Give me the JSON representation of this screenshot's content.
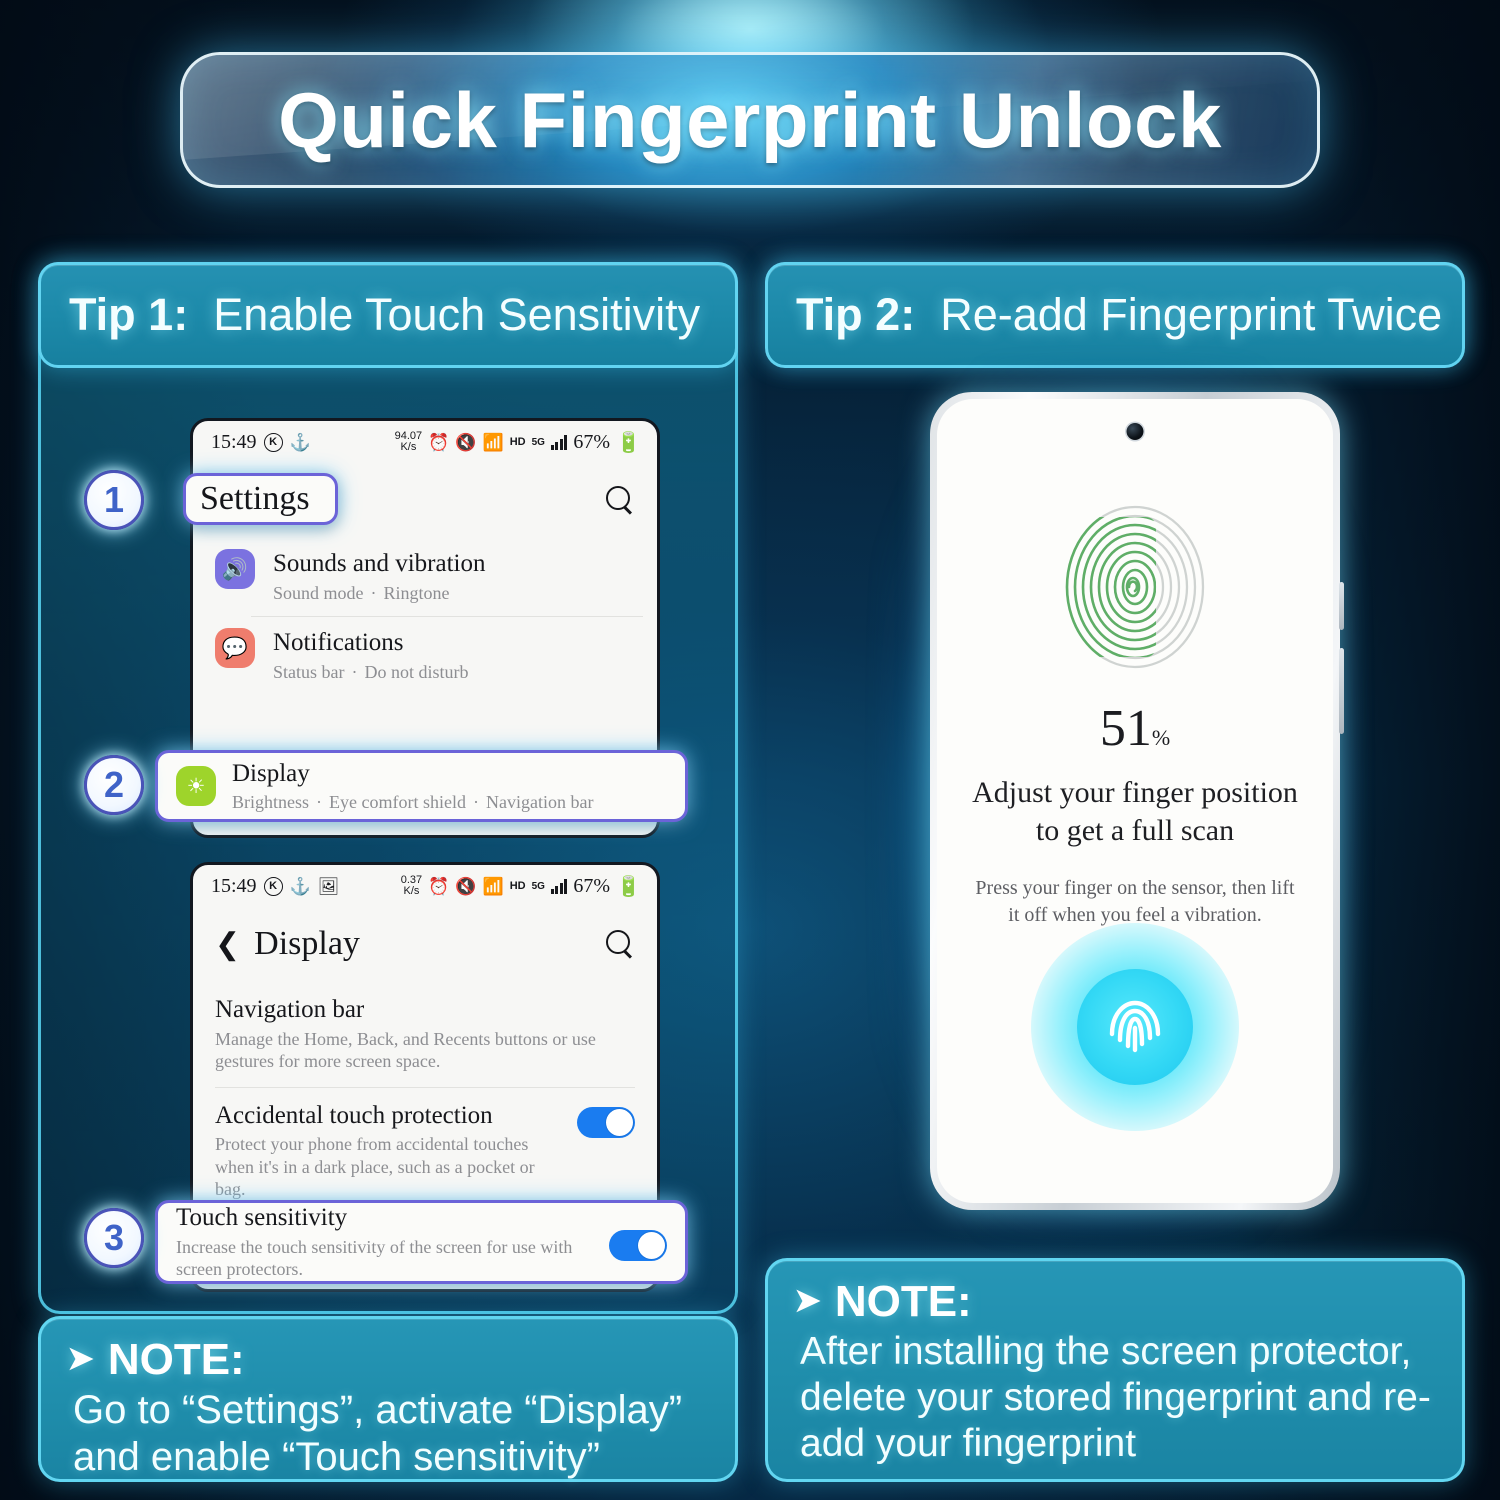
{
  "title": "Quick Fingerprint Unlock",
  "tips": [
    {
      "number_label": "Tip 1:",
      "heading": "Enable Touch Sensitivity"
    },
    {
      "number_label": "Tip 2:",
      "heading": "Re-add Fingerprint Twice"
    }
  ],
  "steps": {
    "one": "1",
    "two": "2",
    "three": "3"
  },
  "phone_settings": {
    "statusbar": {
      "time": "15:49",
      "dnd_badge": "K",
      "speed_value": "94.07",
      "speed_unit": "K/s",
      "alarm_icon": "alarm-icon",
      "mute_icon": "mute-icon",
      "wifi_icon": "wifi-icon",
      "hd": "HD",
      "network": "5G",
      "battery": "67%"
    },
    "app_title": "Settings",
    "search_icon": "search-icon",
    "items": [
      {
        "title": "Sounds and vibration",
        "sub_a": "Sound mode",
        "sub_b": "Ringtone",
        "icon": "speaker-icon"
      },
      {
        "title": "Notifications",
        "sub_a": "Status bar",
        "sub_b": "Do not disturb",
        "icon": "notification-icon"
      }
    ],
    "highlighted_item": {
      "title": "Display",
      "sub_a": "Brightness",
      "sub_b": "Eye comfort shield",
      "sub_c": "Navigation bar",
      "icon": "brightness-icon"
    }
  },
  "phone_display": {
    "statusbar": {
      "time": "15:49",
      "dnd_badge": "K",
      "speed_value": "0.37",
      "speed_unit": "K/s",
      "hd": "HD",
      "network": "5G",
      "battery": "67%"
    },
    "back_icon": "back-chevron-icon",
    "app_title": "Display",
    "search_icon": "search-icon",
    "rows": [
      {
        "title": "Navigation bar",
        "desc": "Manage the Home, Back, and Recents buttons or use gestures for more screen space."
      },
      {
        "title": "Accidental touch protection",
        "desc": "Protect your phone from accidental touches when it's in a dark place, such as a pocket or bag.",
        "toggle": "on"
      }
    ],
    "highlighted_row": {
      "title": "Touch sensitivity",
      "desc": "Increase the touch sensitivity of the screen for use with screen protectors.",
      "toggle": "on"
    }
  },
  "phone_fingerprint": {
    "camera_icon": "front-camera-icon",
    "fingerprint_icon": "fingerprint-graphic",
    "percent_number": "51",
    "percent_symbol": "%",
    "headline": "Adjust your finger position to get a full scan",
    "subtext": "Press your finger on the sensor, then lift it off when you feel a vibration.",
    "sensor_icon": "fingerprint-sensor-icon"
  },
  "notes": [
    {
      "arrow_icon": "arrow-right-icon",
      "label": "NOTE:",
      "body": "Go to “Settings”, activate “Display” and enable “Touch sensitivity”"
    },
    {
      "arrow_icon": "arrow-right-icon",
      "label": "NOTE:",
      "body": "After installing the screen protector, delete your stored fingerprint and re-add your fingerprint"
    }
  ],
  "colors": {
    "accent_cyan": "#46d7ff",
    "panel_teal": "#1d8aaa",
    "toggle_blue": "#1a7cf0",
    "highlight_purple": "#6b63d8",
    "background_navy": "#062239"
  }
}
